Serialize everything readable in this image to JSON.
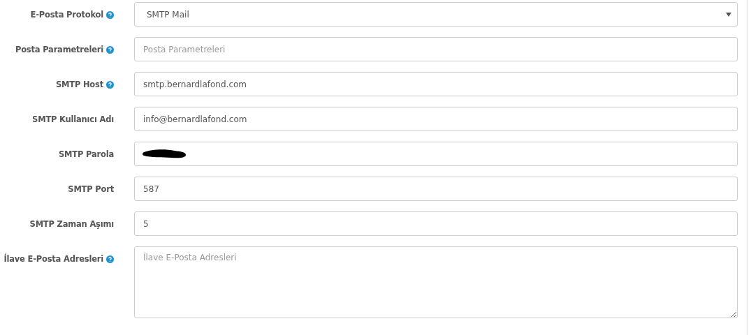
{
  "fields": [
    {
      "kind": "select",
      "label": "E-Posta Protokol",
      "help": true,
      "value": "SMTP Mail"
    },
    {
      "kind": "text",
      "label": "Posta Parametreleri",
      "help": true,
      "placeholder": "Posta Parametreleri"
    },
    {
      "kind": "text",
      "label": "SMTP Host",
      "help": true,
      "value": "smtp.bernardlafond.com"
    },
    {
      "kind": "text",
      "label": "SMTP Kullanıcı Adı",
      "help": false,
      "value": "info@bernardlafond.com"
    },
    {
      "kind": "redacted",
      "label": "SMTP Parola",
      "help": false
    },
    {
      "kind": "text",
      "label": "SMTP Port",
      "help": false,
      "value": "587"
    },
    {
      "kind": "text",
      "label": "SMTP Zaman Aşımı",
      "help": false,
      "value": "5"
    },
    {
      "kind": "textarea",
      "label": "İlave E-Posta Adresleri",
      "help": true,
      "placeholder": "İlave E-Posta Adresleri"
    }
  ]
}
